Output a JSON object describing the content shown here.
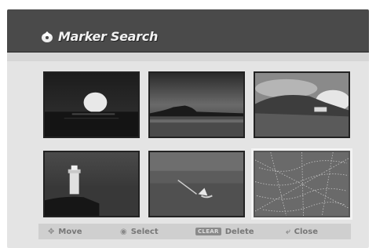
{
  "header": {
    "title": "Marker Search",
    "icon": "disc-icon"
  },
  "thumbnails": [
    {
      "id": "sunset",
      "scene": "sun-over-water"
    },
    {
      "id": "island-dusk",
      "scene": "island-on-horizon"
    },
    {
      "id": "coast-clouds",
      "scene": "hills-and-clouds"
    },
    {
      "id": "lighthouse",
      "scene": "lighthouse-on-rocks"
    },
    {
      "id": "windsurfer",
      "scene": "sailboard-on-lake"
    },
    {
      "id": "spider-web",
      "scene": "dewy-web",
      "selected": true
    }
  ],
  "hints": {
    "move_label": "Move",
    "select_label": "Select",
    "clear_key": "CLEAR",
    "delete_label": "Delete",
    "close_label": "Close"
  }
}
